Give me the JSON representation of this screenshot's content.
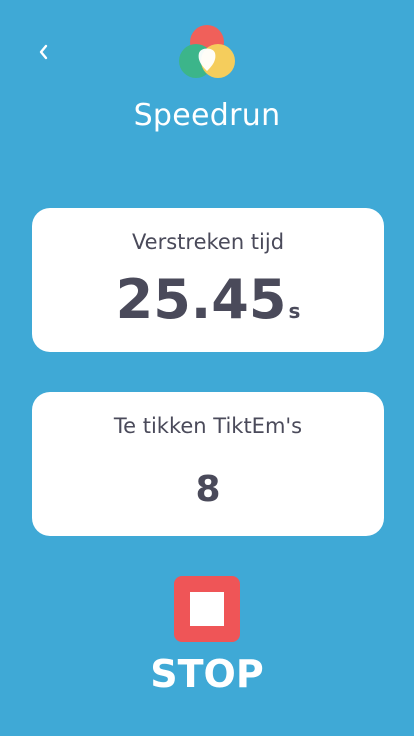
{
  "header": {
    "back_icon": "chevron-left-icon",
    "logo_icon": "tiktem-logo-icon",
    "title": "Speedrun"
  },
  "elapsed": {
    "label": "Verstreken tijd",
    "value": "25.45",
    "unit": "s"
  },
  "remaining": {
    "label": "Te tikken TiktEm's",
    "value": "8"
  },
  "stop": {
    "icon": "stop-icon",
    "label": "STOP"
  },
  "colors": {
    "background": "#3fa9d6",
    "card": "#ffffff",
    "text": "#4a4a5a",
    "stop": "#ef5557",
    "logo_red": "#f0605a",
    "logo_green": "#3cb58a",
    "logo_yellow": "#f5cd5c"
  }
}
